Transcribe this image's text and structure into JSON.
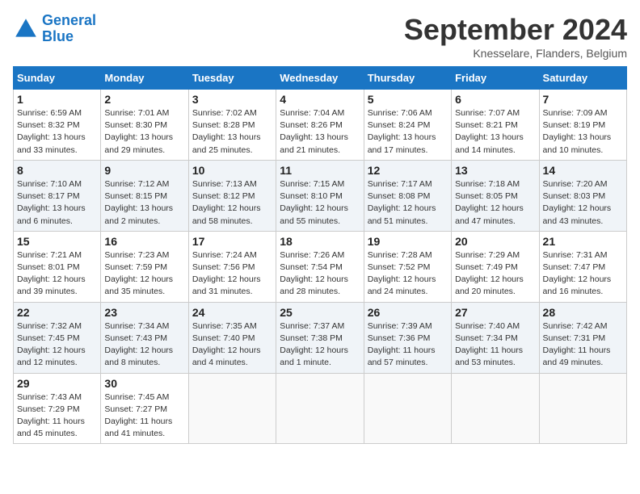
{
  "header": {
    "logo_line1": "General",
    "logo_line2": "Blue",
    "month": "September 2024",
    "location": "Knesselare, Flanders, Belgium"
  },
  "weekdays": [
    "Sunday",
    "Monday",
    "Tuesday",
    "Wednesday",
    "Thursday",
    "Friday",
    "Saturday"
  ],
  "weeks": [
    [
      {
        "day": 1,
        "info": "Sunrise: 6:59 AM\nSunset: 8:32 PM\nDaylight: 13 hours\nand 33 minutes."
      },
      {
        "day": 2,
        "info": "Sunrise: 7:01 AM\nSunset: 8:30 PM\nDaylight: 13 hours\nand 29 minutes."
      },
      {
        "day": 3,
        "info": "Sunrise: 7:02 AM\nSunset: 8:28 PM\nDaylight: 13 hours\nand 25 minutes."
      },
      {
        "day": 4,
        "info": "Sunrise: 7:04 AM\nSunset: 8:26 PM\nDaylight: 13 hours\nand 21 minutes."
      },
      {
        "day": 5,
        "info": "Sunrise: 7:06 AM\nSunset: 8:24 PM\nDaylight: 13 hours\nand 17 minutes."
      },
      {
        "day": 6,
        "info": "Sunrise: 7:07 AM\nSunset: 8:21 PM\nDaylight: 13 hours\nand 14 minutes."
      },
      {
        "day": 7,
        "info": "Sunrise: 7:09 AM\nSunset: 8:19 PM\nDaylight: 13 hours\nand 10 minutes."
      }
    ],
    [
      {
        "day": 8,
        "info": "Sunrise: 7:10 AM\nSunset: 8:17 PM\nDaylight: 13 hours\nand 6 minutes."
      },
      {
        "day": 9,
        "info": "Sunrise: 7:12 AM\nSunset: 8:15 PM\nDaylight: 13 hours\nand 2 minutes."
      },
      {
        "day": 10,
        "info": "Sunrise: 7:13 AM\nSunset: 8:12 PM\nDaylight: 12 hours\nand 58 minutes."
      },
      {
        "day": 11,
        "info": "Sunrise: 7:15 AM\nSunset: 8:10 PM\nDaylight: 12 hours\nand 55 minutes."
      },
      {
        "day": 12,
        "info": "Sunrise: 7:17 AM\nSunset: 8:08 PM\nDaylight: 12 hours\nand 51 minutes."
      },
      {
        "day": 13,
        "info": "Sunrise: 7:18 AM\nSunset: 8:05 PM\nDaylight: 12 hours\nand 47 minutes."
      },
      {
        "day": 14,
        "info": "Sunrise: 7:20 AM\nSunset: 8:03 PM\nDaylight: 12 hours\nand 43 minutes."
      }
    ],
    [
      {
        "day": 15,
        "info": "Sunrise: 7:21 AM\nSunset: 8:01 PM\nDaylight: 12 hours\nand 39 minutes."
      },
      {
        "day": 16,
        "info": "Sunrise: 7:23 AM\nSunset: 7:59 PM\nDaylight: 12 hours\nand 35 minutes."
      },
      {
        "day": 17,
        "info": "Sunrise: 7:24 AM\nSunset: 7:56 PM\nDaylight: 12 hours\nand 31 minutes."
      },
      {
        "day": 18,
        "info": "Sunrise: 7:26 AM\nSunset: 7:54 PM\nDaylight: 12 hours\nand 28 minutes."
      },
      {
        "day": 19,
        "info": "Sunrise: 7:28 AM\nSunset: 7:52 PM\nDaylight: 12 hours\nand 24 minutes."
      },
      {
        "day": 20,
        "info": "Sunrise: 7:29 AM\nSunset: 7:49 PM\nDaylight: 12 hours\nand 20 minutes."
      },
      {
        "day": 21,
        "info": "Sunrise: 7:31 AM\nSunset: 7:47 PM\nDaylight: 12 hours\nand 16 minutes."
      }
    ],
    [
      {
        "day": 22,
        "info": "Sunrise: 7:32 AM\nSunset: 7:45 PM\nDaylight: 12 hours\nand 12 minutes."
      },
      {
        "day": 23,
        "info": "Sunrise: 7:34 AM\nSunset: 7:43 PM\nDaylight: 12 hours\nand 8 minutes."
      },
      {
        "day": 24,
        "info": "Sunrise: 7:35 AM\nSunset: 7:40 PM\nDaylight: 12 hours\nand 4 minutes."
      },
      {
        "day": 25,
        "info": "Sunrise: 7:37 AM\nSunset: 7:38 PM\nDaylight: 12 hours\nand 1 minute."
      },
      {
        "day": 26,
        "info": "Sunrise: 7:39 AM\nSunset: 7:36 PM\nDaylight: 11 hours\nand 57 minutes."
      },
      {
        "day": 27,
        "info": "Sunrise: 7:40 AM\nSunset: 7:34 PM\nDaylight: 11 hours\nand 53 minutes."
      },
      {
        "day": 28,
        "info": "Sunrise: 7:42 AM\nSunset: 7:31 PM\nDaylight: 11 hours\nand 49 minutes."
      }
    ],
    [
      {
        "day": 29,
        "info": "Sunrise: 7:43 AM\nSunset: 7:29 PM\nDaylight: 11 hours\nand 45 minutes."
      },
      {
        "day": 30,
        "info": "Sunrise: 7:45 AM\nSunset: 7:27 PM\nDaylight: 11 hours\nand 41 minutes."
      },
      null,
      null,
      null,
      null,
      null
    ]
  ]
}
